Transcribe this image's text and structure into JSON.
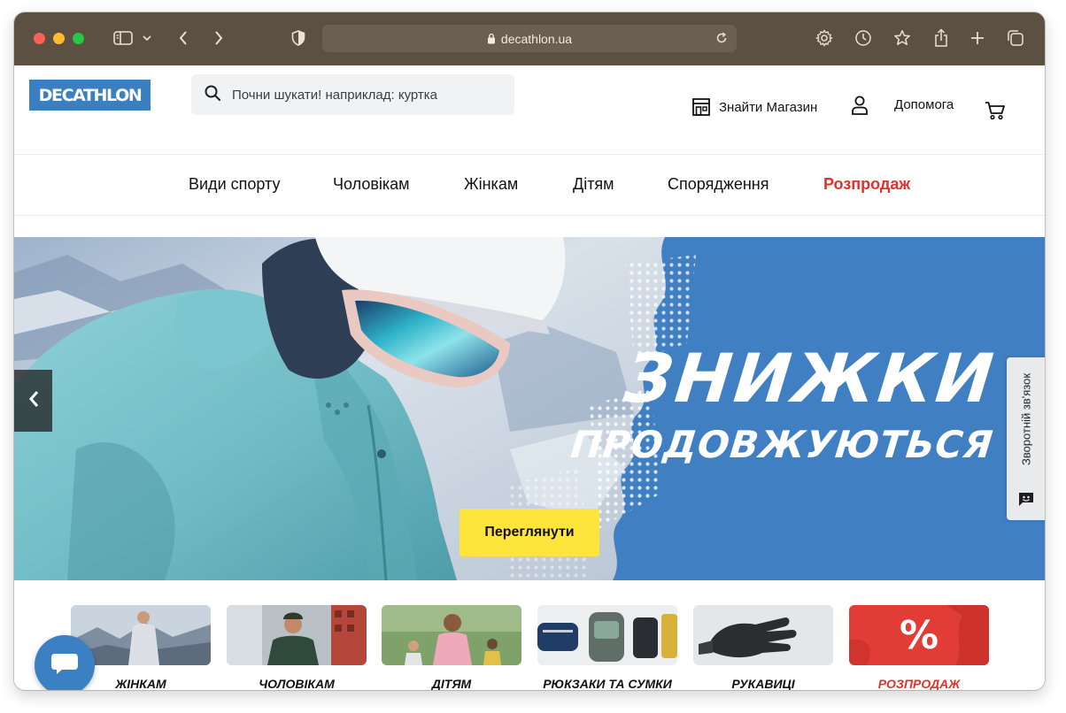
{
  "browser": {
    "url": "decathlon.ua"
  },
  "header": {
    "logo_text": "DECATHLON",
    "search_placeholder": "Почни шукати! наприклад: куртка",
    "find_store": "Знайти Магазин",
    "help": "Допомога"
  },
  "nav": {
    "items": [
      "Види спорту",
      "Чоловікам",
      "Жінкам",
      "Дітям",
      "Спорядження",
      "Розпродаж"
    ]
  },
  "hero": {
    "title": "ЗНИЖКИ",
    "subtitle": "ПРОДОВЖУЮТЬСЯ",
    "cta": "Переглянути"
  },
  "feedback_tab": "Зворотній зв'язок",
  "categories": [
    {
      "label": "ЖІНКАМ"
    },
    {
      "label": "ЧОЛОВІКАМ"
    },
    {
      "label": "ДІТЯМ"
    },
    {
      "label": "РЮКЗАКИ ТА СУМКИ"
    },
    {
      "label": "РУКАВИЦІ"
    },
    {
      "label": "РОЗПРОДАЖ",
      "sale_glyph": "%"
    }
  ],
  "colors": {
    "brand_blue": "#3a7fc1",
    "sale_red": "#e0322b",
    "cta_yellow": "#ffe43b",
    "browser_chrome": "#5b5042"
  }
}
